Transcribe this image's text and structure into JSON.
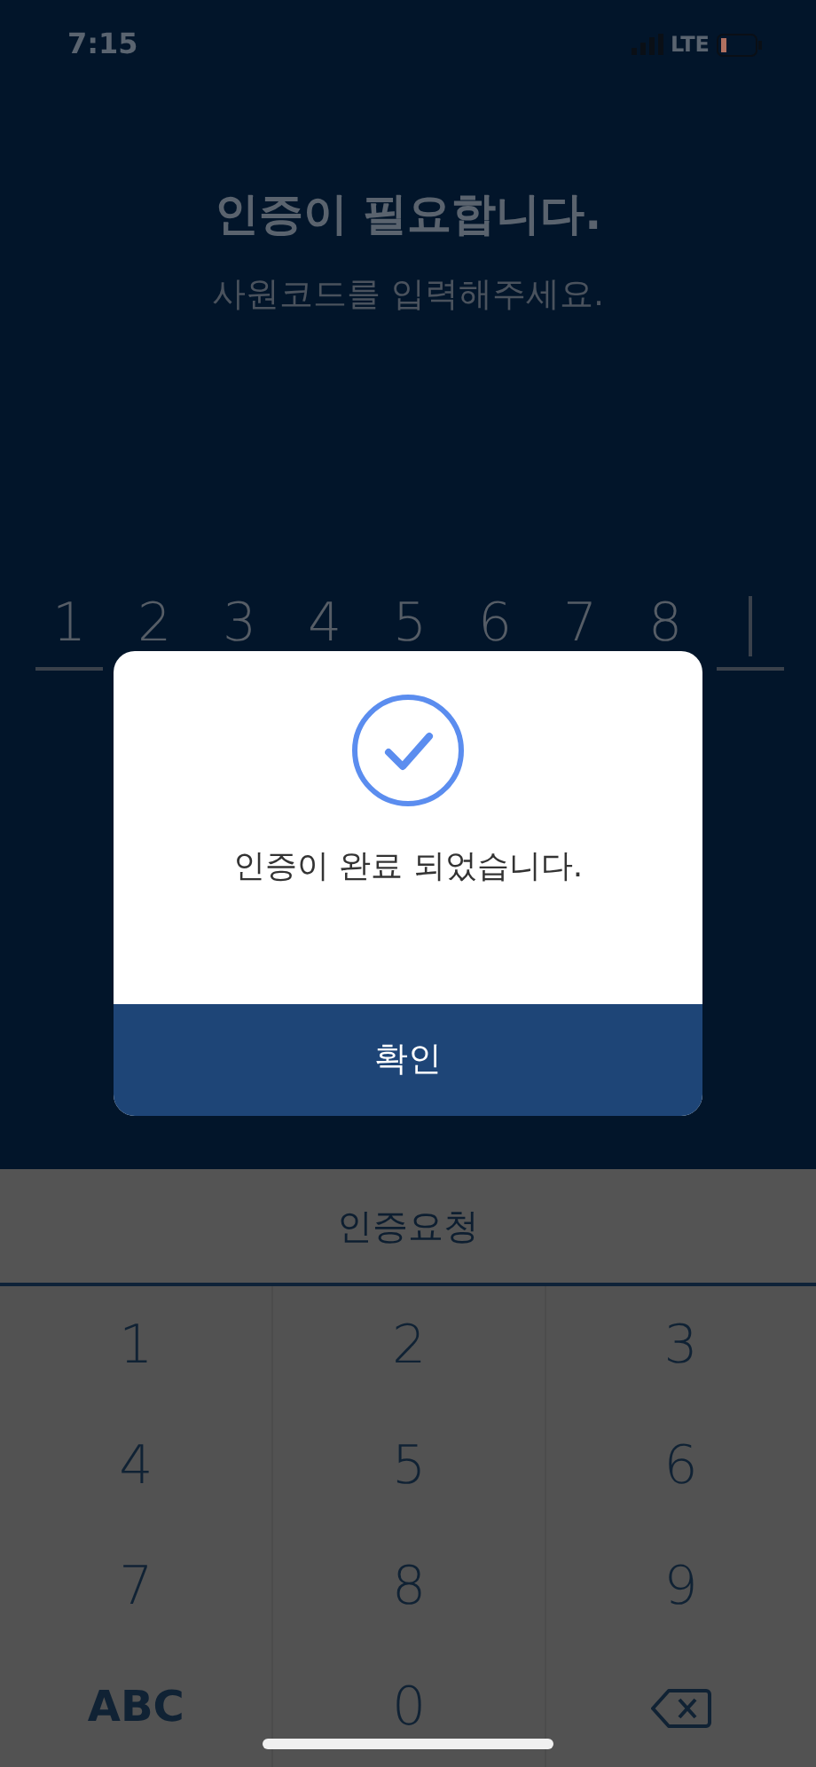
{
  "status_bar": {
    "time": "7:15",
    "network": "LTE"
  },
  "header": {
    "title": "인증이 필요합니다.",
    "subtitle": "사원코드를 입력해주세요."
  },
  "code_input": {
    "digits": [
      "1",
      "2",
      "3",
      "4",
      "5",
      "6",
      "7",
      "8"
    ]
  },
  "dialog": {
    "message": "인증이 완료 되었습니다.",
    "confirm_button": "확인"
  },
  "request_button": "인증요청",
  "keypad": {
    "keys": [
      {
        "kind": "digit",
        "label": "1"
      },
      {
        "kind": "digit",
        "label": "2"
      },
      {
        "kind": "digit",
        "label": "3"
      },
      {
        "kind": "digit",
        "label": "4"
      },
      {
        "kind": "digit",
        "label": "5"
      },
      {
        "kind": "digit",
        "label": "6"
      },
      {
        "kind": "digit",
        "label": "7"
      },
      {
        "kind": "digit",
        "label": "8"
      },
      {
        "kind": "digit",
        "label": "9"
      },
      {
        "kind": "mode",
        "label": "ABC"
      },
      {
        "kind": "digit",
        "label": "0"
      },
      {
        "kind": "backspace"
      }
    ]
  }
}
